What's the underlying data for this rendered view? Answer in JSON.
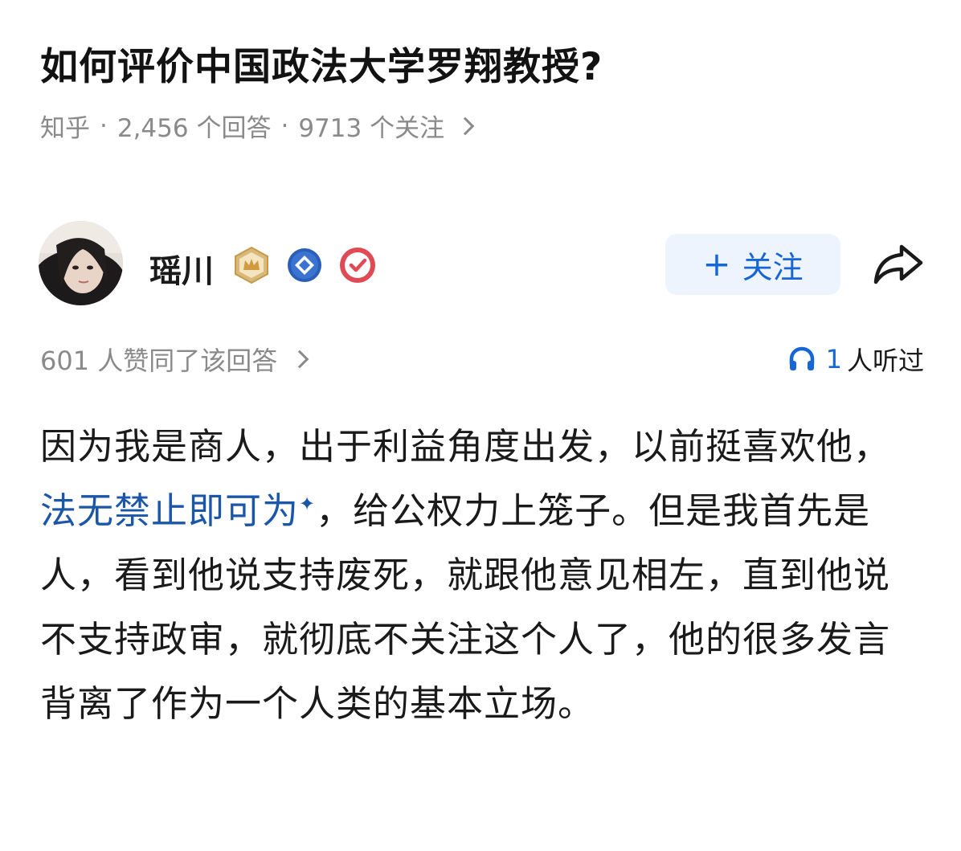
{
  "question": {
    "title": "如何评价中国政法大学罗翔教授?",
    "source": "知乎",
    "answers": "2,456 个回答",
    "followers": "9713 个关注"
  },
  "author": {
    "name": "瑶川",
    "follow_label": "关注"
  },
  "answer_stats": {
    "votes": "601 人赞同了该回答",
    "listen_count": "1",
    "listen_label": "人听过"
  },
  "answer": {
    "text_1": "因为我是商人，出于利益角度出发，以前挺喜欢他，",
    "link_text": "法无禁止即可为",
    "text_2": "，给公权力上笼子。但是我首先是人，看到他说支持废死，就跟他意见相左，直到他说不支持政审，就彻底不关注这个人了，他的很多发言背离了作为一个人类的基本立场。"
  },
  "colors": {
    "accent": "#1766d6",
    "link": "#1b56a8",
    "meta": "#8a8a8a",
    "follow_bg": "#eef4fd"
  },
  "icons": {
    "share": "share-icon",
    "headphone": "headphone-icon",
    "badge_crown": "crown-badge-icon",
    "badge_diamond": "diamond-badge-icon",
    "badge_verified": "verified-badge-icon"
  }
}
